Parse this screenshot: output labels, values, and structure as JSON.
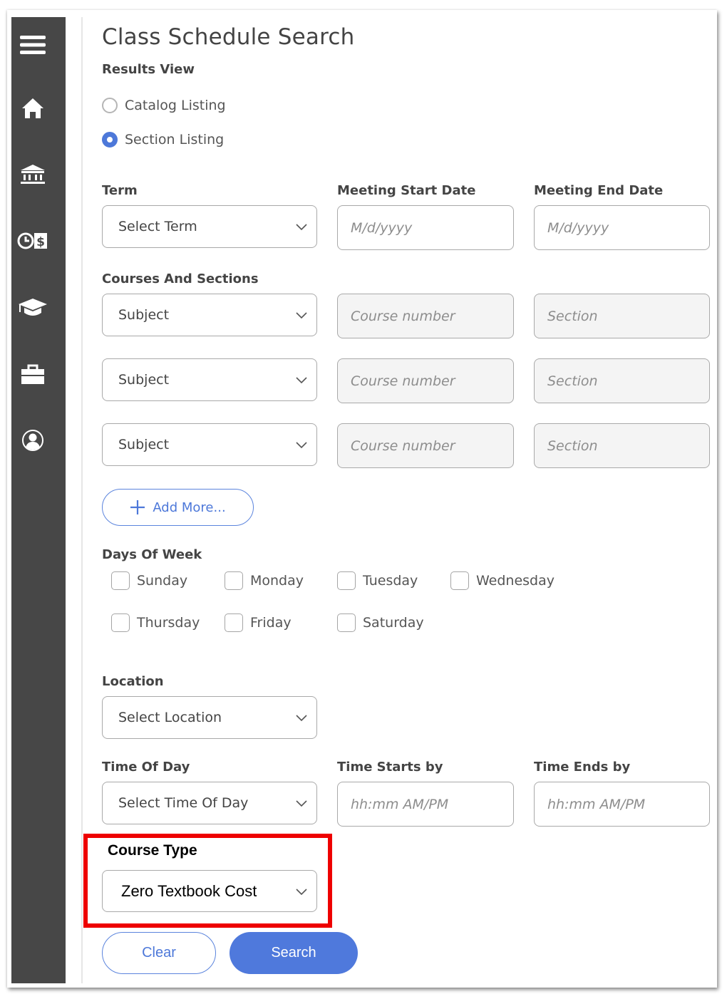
{
  "sidebar": {
    "items": [
      {
        "name": "menu",
        "icon": "hamburger-menu-icon"
      },
      {
        "name": "home",
        "icon": "home-icon"
      },
      {
        "name": "institution",
        "icon": "bank-building-icon"
      },
      {
        "name": "financial",
        "icon": "clock-dollar-icon"
      },
      {
        "name": "academics",
        "icon": "graduation-cap-icon"
      },
      {
        "name": "employment",
        "icon": "briefcase-icon"
      },
      {
        "name": "profile",
        "icon": "user-circle-icon"
      }
    ]
  },
  "page": {
    "title": "Class Schedule Search"
  },
  "results_view": {
    "label": "Results View",
    "options": [
      {
        "label": "Catalog Listing",
        "selected": false
      },
      {
        "label": "Section Listing",
        "selected": true
      }
    ]
  },
  "term": {
    "label": "Term",
    "value": "Select Term"
  },
  "meeting_start": {
    "label": "Meeting Start Date",
    "placeholder": "M/d/yyyy",
    "value": ""
  },
  "meeting_end": {
    "label": "Meeting End Date",
    "placeholder": "M/d/yyyy",
    "value": ""
  },
  "courses": {
    "label": "Courses And Sections",
    "rows": [
      {
        "subject": "Subject",
        "course_placeholder": "Course number",
        "section_placeholder": "Section"
      },
      {
        "subject": "Subject",
        "course_placeholder": "Course number",
        "section_placeholder": "Section"
      },
      {
        "subject": "Subject",
        "course_placeholder": "Course number",
        "section_placeholder": "Section"
      }
    ],
    "add_more_label": "Add More..."
  },
  "days_of_week": {
    "label": "Days Of Week",
    "days": [
      {
        "label": "Sunday",
        "checked": false
      },
      {
        "label": "Monday",
        "checked": false
      },
      {
        "label": "Tuesday",
        "checked": false
      },
      {
        "label": "Wednesday",
        "checked": false
      },
      {
        "label": "Thursday",
        "checked": false
      },
      {
        "label": "Friday",
        "checked": false
      },
      {
        "label": "Saturday",
        "checked": false
      }
    ]
  },
  "location": {
    "label": "Location",
    "value": "Select Location"
  },
  "time_of_day": {
    "label": "Time Of Day",
    "value": "Select Time Of Day"
  },
  "time_starts": {
    "label": "Time Starts by",
    "placeholder": "hh:mm AM/PM",
    "value": ""
  },
  "time_ends": {
    "label": "Time Ends by",
    "placeholder": "hh:mm AM/PM",
    "value": ""
  },
  "course_type": {
    "label": "Course Type",
    "value": "Zero Textbook Cost",
    "highlight_color": "#ee0000"
  },
  "actions": {
    "clear_label": "Clear",
    "search_label": "Search"
  },
  "colors": {
    "accent": "#4f79dc",
    "sidebar": "#474747"
  }
}
